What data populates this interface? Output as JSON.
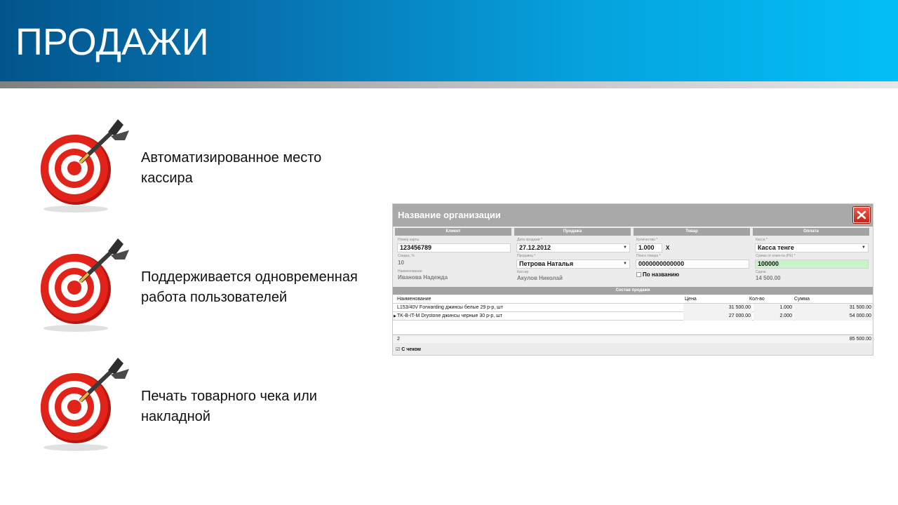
{
  "slide": {
    "title": "ПРОДАЖИ"
  },
  "bullets": [
    {
      "icon": "target-dart-icon",
      "line1": "Автоматизированное место",
      "line2": "кассира"
    },
    {
      "icon": "target-dart-icon",
      "line1": "Поддерживается одновременная",
      "line2": "работа пользователей"
    },
    {
      "icon": "target-dart-icon",
      "line1": "Печать товарного чека или",
      "line2": "накладной"
    }
  ],
  "colors": {
    "header_dark": "#02558c",
    "header_light": "#03bff5",
    "target_red": "#e2231a",
    "window_title_bg": "#a9a9a9",
    "amount_field_bg": "#c8f5c8"
  },
  "window": {
    "title": "Название организации",
    "close_icon": "close-icon",
    "panels": {
      "client": {
        "header": "Клиент",
        "card_label": "Номер карты",
        "card_value": "123456789",
        "discount_label": "Скидка, %",
        "discount_value": "10",
        "name_label": "Наименование",
        "name_value": "Иванова Надежда"
      },
      "sale": {
        "header": "Продажа",
        "date_label": "Дата продажи *",
        "date_value": "27.12.2012",
        "seller_label": "Продавец *",
        "seller_value": "Петрова Наталья",
        "cashier_label": "Кассир",
        "cashier_value": "Акулов Николай"
      },
      "product": {
        "header": "Товар",
        "qty_label": "Количество *",
        "qty_value": "1.000",
        "qty_mult": "X",
        "search_label": "Поиск товара *",
        "search_value": "0000000000000",
        "by_name_label": "По названию"
      },
      "payment": {
        "header": "Оплата",
        "register_label": "Касса *",
        "register_value": "Касса тенге",
        "amount_label": "Сумма от клиента (РЕ) *",
        "amount_value": "100000",
        "change_label": "Сдача",
        "change_value": "14 500.00"
      }
    },
    "sale_items": {
      "header": "Состав продажи",
      "columns": [
        "Наименование",
        "Цена",
        "Кол-во",
        "Сумма"
      ],
      "rows": [
        {
          "name": "L153/40V Forwarding джинсы белые 29 р-р, шт",
          "price": "31 500.00",
          "qty": "1.000",
          "sum": "31 500.00"
        },
        {
          "name": "TK-B-IT-M Drystone джинсы черные 30 р-р, шт",
          "price": "27 000.00",
          "qty": "2.000",
          "sum": "54 000.00"
        }
      ],
      "footer_count": "2",
      "footer_total": "85 500.00"
    },
    "with_receipt_label": "С чеком"
  }
}
